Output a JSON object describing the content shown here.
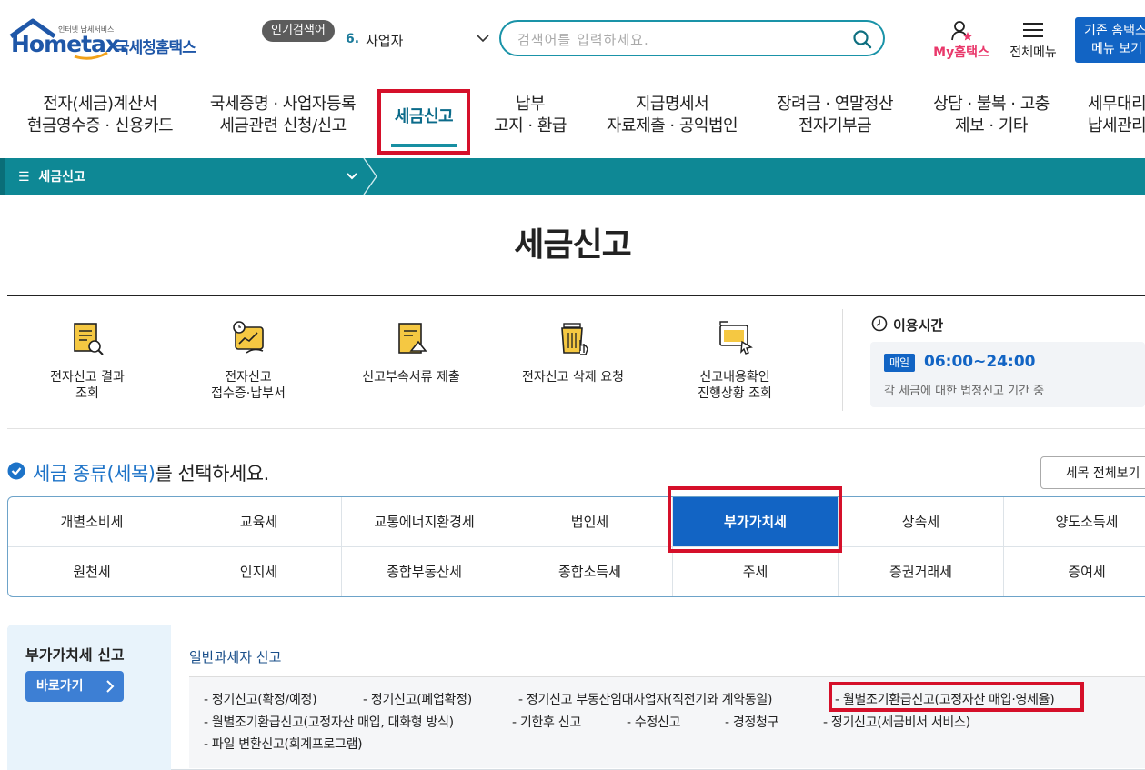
{
  "header": {
    "logo_small": "인터넷 납세서비스",
    "logo_home": "Home",
    "logo_tax": "tax.",
    "logo_korean": "국세청홈택스",
    "popular_badge": "인기검색어",
    "popular_rank": "6.",
    "popular_term": "사업자",
    "search_placeholder": "검색어를 입력하세요.",
    "myhometax": "My홈택스",
    "allmenu": "전체메뉴",
    "oldmenu_line1": "기존 홈택스",
    "oldmenu_line2": "메뉴 보기"
  },
  "gnb": [
    {
      "line1": "전자(세금)계산서",
      "line2": "현금영수증 · 신용카드"
    },
    {
      "line1": "국세증명 · 사업자등록",
      "line2": "세금관련 신청/신고"
    },
    {
      "line1": "세금신고",
      "line2": ""
    },
    {
      "line1": "납부",
      "line2": "고지 · 환급"
    },
    {
      "line1": "지급명세서",
      "line2": "자료제출 · 공익법인"
    },
    {
      "line1": "장려금 · 연말정산",
      "line2": "전자기부금"
    },
    {
      "line1": "상담 · 불복 · 고충",
      "line2": "제보 · 기타"
    },
    {
      "line1": "세무대리",
      "line2": "납세관리"
    }
  ],
  "breadcrumb": {
    "menu_label": "세금신고"
  },
  "page_title": "세금신고",
  "quick_menu": [
    {
      "label": "전자신고 결과\n조회",
      "icon": "document-search-icon"
    },
    {
      "label": "전자신고\n접수증·납부서",
      "icon": "receipt-chart-icon"
    },
    {
      "label": "신고부속서류 제출",
      "icon": "document-upload-icon"
    },
    {
      "label": "전자신고 삭제 요청",
      "icon": "trash-click-icon"
    },
    {
      "label": "신고내용확인\n진행상황 조회",
      "icon": "monitor-cursor-icon"
    }
  ],
  "usage_time": {
    "title": "이용시간",
    "badge": "매일",
    "range": "06:00~24:00",
    "desc": "각 세금에 대한 법정신고 기간 중"
  },
  "tax_select": {
    "title_highlight": "세금 종류(세목)",
    "title_rest": "를 선택하세요.",
    "view_all": "세목 전체보기",
    "row1": [
      "개별소비세",
      "교육세",
      "교통에너지환경세",
      "법인세",
      "부가가치세",
      "상속세",
      "양도소득세"
    ],
    "row2": [
      "원천세",
      "인지세",
      "종합부동산세",
      "종합소득세",
      "주세",
      "증권거래세",
      "증여세"
    ],
    "active": "부가가치세"
  },
  "vat_panel": {
    "title": "부가가치세 신고",
    "goto": "바로가기",
    "general_title": "일반과세자 신고",
    "links_row1": [
      "- 정기신고(확정/예정)",
      "- 정기신고(폐업확정)",
      "- 정기신고 부동산임대사업자(직전기와 계약동일)",
      "- 월별조기환급신고(고정자산 매입·영세율)"
    ],
    "links_row2": [
      "- 월별조기환급신고(고정자산 매입, 대화형 방식)",
      "- 기한후 신고",
      "- 수정신고",
      "- 경정청구",
      "- 정기신고(세금비서 서비스)"
    ],
    "links_row3": [
      "- 파일 변환신고(회계프로그램)"
    ]
  },
  "colors": {
    "accent": "#1264c4",
    "teal": "#0e8895",
    "highlight_box": "#d5102a"
  }
}
